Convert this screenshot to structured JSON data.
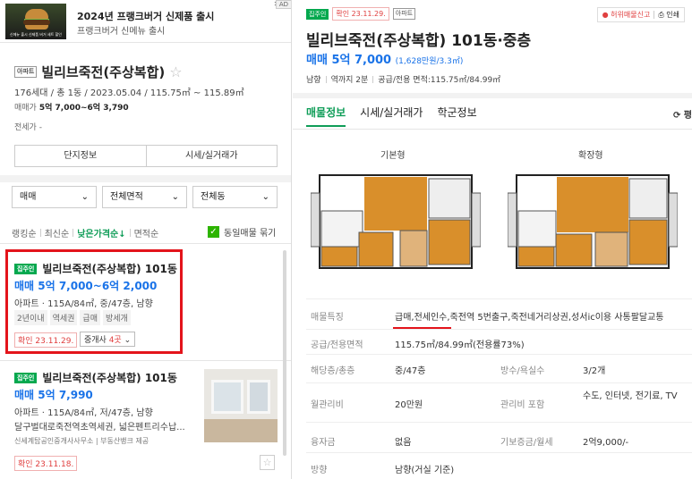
{
  "ad": {
    "badge": "AD",
    "close": "✕",
    "title": "2024년 프랭크버거 신제품 출시",
    "subtitle": "프랭크버거 신메뉴 출시",
    "thumb_caption": "신메뉴 출시 신제품 버거 세트 할인"
  },
  "complex": {
    "type_tag": "아파트",
    "name": "빌리브죽전(주상복합)",
    "info": "176세대 / 총 1동 / 2023.05.04 / 115.75㎡ ~ 115.89㎡",
    "sale_label": "매매가",
    "sale_value": "5억 7,000~6억 3,790",
    "jeonse_label": "전세가 -"
  },
  "buttons": {
    "complex_info": "단지정보",
    "price_info": "시세/실거래가"
  },
  "filters": {
    "trade": "매매",
    "area": "전체면적",
    "dong": "전체동"
  },
  "sort": {
    "items": [
      "랭킹순",
      "최신순",
      "낮은가격순↓",
      "면적순"
    ],
    "same_listing": "동일매물 묶기"
  },
  "listings": [
    {
      "badge": "집주인",
      "title": "빌리브죽전(주상복합) 101동",
      "price": "매매 5억 7,000~6억 2,000",
      "spec": "아파트 · 115A/84㎡, 중/47층, 남향",
      "chips": [
        "2년이내",
        "역세권",
        "급매",
        "방세개"
      ],
      "confirm": "확인 23.11.29.",
      "agent_prefix": "중개사 ",
      "agent_count": "4곳",
      "agent_suffix": " ⌄"
    },
    {
      "badge": "집주인",
      "title": "빌리브죽전(주상복합) 101동",
      "price": "매매 5억 7,990",
      "spec": "아파트 · 115A/84㎡, 저/47층, 남향",
      "desc": "달구벌대로죽전역초역세권, 넓은펜트리수납...",
      "agency": "신세계탑공인중개사사무소 | 부동산뱅크 제공",
      "confirm": "확인 23.11.18."
    }
  ],
  "detail": {
    "badge": "집주인",
    "confirm": "확인 23.11.29.",
    "type_tag": "아파트",
    "report": "허위매물신고",
    "print": "인쇄",
    "title": "빌리브죽전(주상복합) 101동·중층",
    "price": "매매 5억 7,000",
    "price_per": "(1,628만원/3.3㎡)",
    "meta": [
      "남향",
      "역까지 2분",
      "공급/전용 면적:115.75㎡/84.99㎡"
    ],
    "tabs": [
      "매물정보",
      "시세/실거래가",
      "학군정보"
    ],
    "refresh": "⟳ 평",
    "plans": [
      "기본형",
      "확장형"
    ],
    "rows": [
      {
        "label": "매물특징",
        "value": "급매,전세인수,죽전역 5번출구,죽전네거리상권,성서ic이용 사통팔달교통"
      },
      {
        "label": "공급/전용면적",
        "value": "115.75㎡/84.99㎡(전용률73%)"
      },
      {
        "label": "해당층/총층",
        "value": "중/47층",
        "label2": "방수/욕실수",
        "value2": "3/2개"
      },
      {
        "label": "월관리비",
        "value": "20만원",
        "label2": "관리비 포함",
        "value2": "수도, 인터넷, 전기료, TV"
      },
      {
        "label": "융자금",
        "value": "없음",
        "label2": "기보증금/월세",
        "value2": "2억9,000/-"
      },
      {
        "label": "방향",
        "value": "남향(거실 기준)"
      }
    ]
  },
  "colors": {
    "accent_green": "#0f9d58",
    "price_blue": "#1a73e8",
    "highlight_red": "#e3141b"
  }
}
